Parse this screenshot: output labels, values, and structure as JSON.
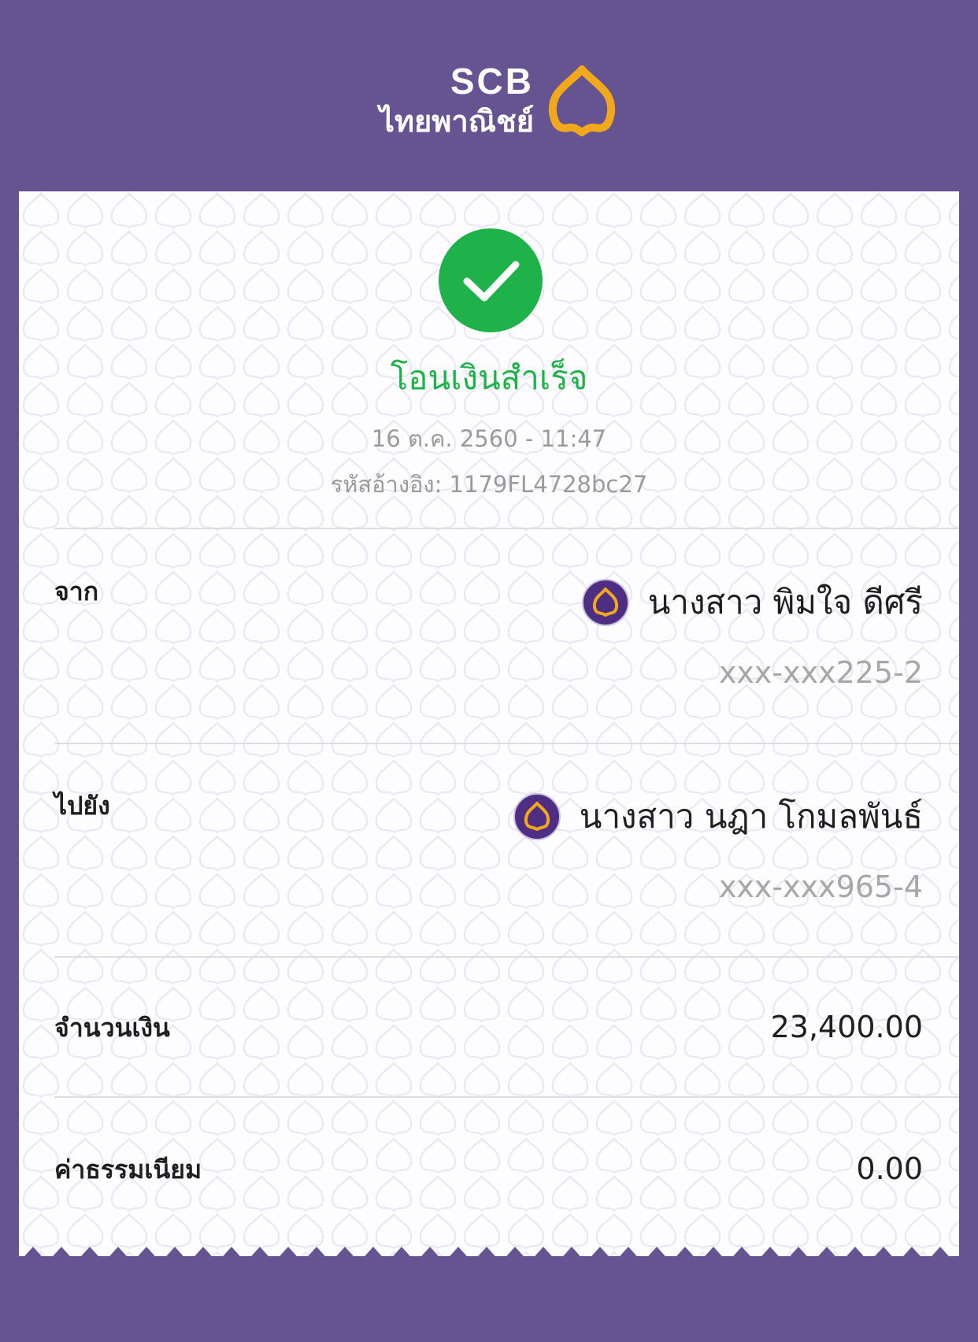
{
  "brand": {
    "name_en": "SCB",
    "name_th": "ไทยพาณิชย์",
    "background_color": "#655392",
    "accent_color": "#f2a81d",
    "logo_icon": "scb-bodhi-leaf-icon"
  },
  "receipt": {
    "status_icon": "checkmark-icon",
    "status_color": "#20b24a",
    "status_title": "โอนเงินสำเร็จ",
    "datetime": "16 ต.ค. 2560 - 11:47",
    "reference": "รหัสอ้างอิง: 1179FL4728bc27",
    "from": {
      "label": "จาก",
      "bank_icon": "scb-bank-icon",
      "name": "นางสาว พิมใจ ดีศรี",
      "account": "xxx-xxx225-2"
    },
    "to": {
      "label": "ไปยัง",
      "bank_icon": "scb-bank-icon",
      "name": "นางสาว นฎา โกมลพันธ์",
      "account": "xxx-xxx965-4"
    },
    "amount": {
      "label": "จำนวนเงิน",
      "value": "23,400.00"
    },
    "fee": {
      "label": "ค่าธรรมเนียม",
      "value": "0.00"
    }
  }
}
